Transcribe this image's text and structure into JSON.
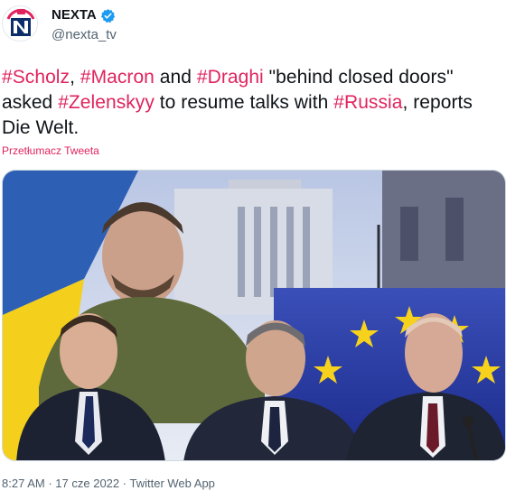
{
  "author": {
    "name": "NEXTA",
    "handle": "@nexta_tv",
    "avatar_icon": "nexta-logo-icon",
    "verified_icon": "verified-badge-icon",
    "brand_color": "#e0245e",
    "verified_color": "#1d9bf0"
  },
  "tweet": {
    "parts": [
      {
        "text": "#Scholz",
        "hashtag": true
      },
      {
        "text": ", ",
        "hashtag": false
      },
      {
        "text": "#Macron",
        "hashtag": true
      },
      {
        "text": " and ",
        "hashtag": false
      },
      {
        "text": "#Draghi",
        "hashtag": true
      },
      {
        "text": " \"behind closed doors\" asked ",
        "hashtag": false
      },
      {
        "text": "#Zelenskyy",
        "hashtag": true
      },
      {
        "text": " to resume talks with ",
        "hashtag": false
      },
      {
        "text": "#Russia",
        "hashtag": true
      },
      {
        "text": ", reports Die Welt.",
        "hashtag": false
      }
    ],
    "translate_link": "Przetłumacz Tweeta"
  },
  "media": {
    "kind": "photo-collage"
  },
  "footer": {
    "time": "8:27 AM",
    "separator": "·",
    "date": "17 cze 2022",
    "source": "Twitter Web App"
  }
}
